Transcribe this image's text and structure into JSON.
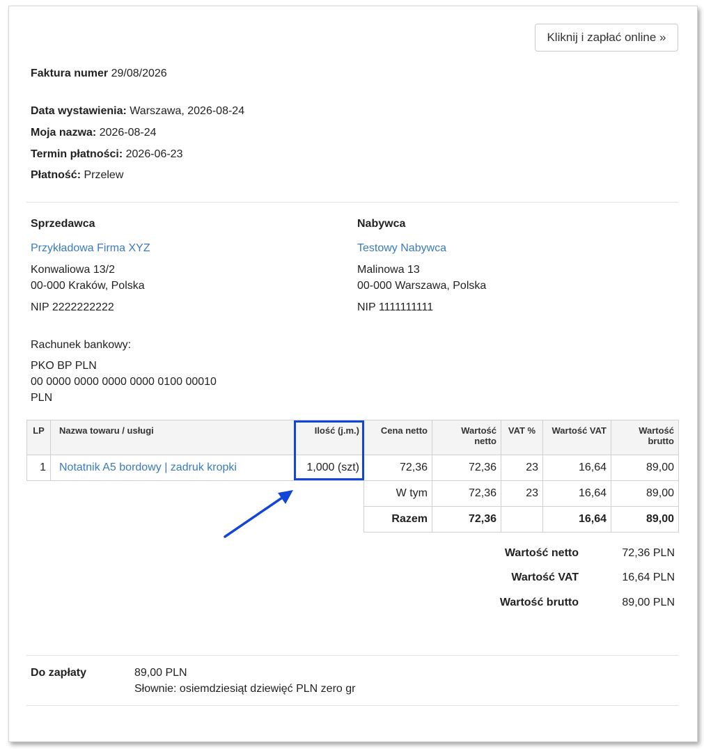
{
  "header": {
    "pay_button_label": "Kliknij i zapłać online »"
  },
  "invoice": {
    "number_label": "Faktura numer",
    "number_value": "29/08/2026",
    "details": [
      {
        "label": "Data wystawienia:",
        "value": "Warszawa, 2026-08-24"
      },
      {
        "label": "Moja nazwa:",
        "value": "2026-08-24"
      },
      {
        "label": "Termin płatności:",
        "value": "2026-06-23"
      },
      {
        "label": "Płatność:",
        "value": "Przelew"
      }
    ]
  },
  "seller": {
    "heading": "Sprzedawca",
    "name": "Przykładowa Firma XYZ",
    "street": "Konwaliowa 13/2",
    "city": "00-000 Kraków, Polska",
    "nip": "NIP 2222222222"
  },
  "buyer": {
    "heading": "Nabywca",
    "name": "Testowy Nabywca",
    "street": "Malinowa 13",
    "city": "00-000 Warszawa, Polska",
    "nip": "NIP 1111111111"
  },
  "bank": {
    "label": "Rachunek bankowy:",
    "bank_name": "PKO BP PLN",
    "account": "00 0000 0000 0000 0000 0100 00010",
    "currency": "PLN"
  },
  "items_table": {
    "headers": {
      "lp": "LP",
      "name": "Nazwa towaru / usługi",
      "qty": "Ilość (j.m.)",
      "unit_net": "Cena netto",
      "net_value": "Wartość netto",
      "vat_pct": "VAT %",
      "vat_value": "Wartość VAT",
      "gross_line1": "Wartość",
      "gross_line2": "brutto"
    },
    "rows": [
      {
        "lp": "1",
        "name": "Notatnik A5 bordowy | zadruk kropki",
        "qty": "1,000 (szt)",
        "unit_net": "72,36",
        "net_value": "72,36",
        "vat_pct": "23",
        "vat_value": "16,64",
        "gross": "89,00"
      }
    ],
    "subtotal": {
      "label": "W tym",
      "net_value": "72,36",
      "vat_pct": "23",
      "vat_value": "16,64",
      "gross": "89,00"
    },
    "total": {
      "label": "Razem",
      "net_value": "72,36",
      "vat_pct": "",
      "vat_value": "16,64",
      "gross": "89,00"
    }
  },
  "summary": [
    {
      "label": "Wartość netto",
      "value": "72,36 PLN"
    },
    {
      "label": "Wartość VAT",
      "value": "16,64 PLN"
    },
    {
      "label": "Wartość brutto",
      "value": "89,00 PLN"
    }
  ],
  "payment_due": {
    "label": "Do zapłaty",
    "amount": "89,00 PLN",
    "words": "Słownie: osiemdziesiąt dziewięć PLN zero gr"
  },
  "colors": {
    "link": "#3a7bbf",
    "highlight": "#1246d6"
  }
}
